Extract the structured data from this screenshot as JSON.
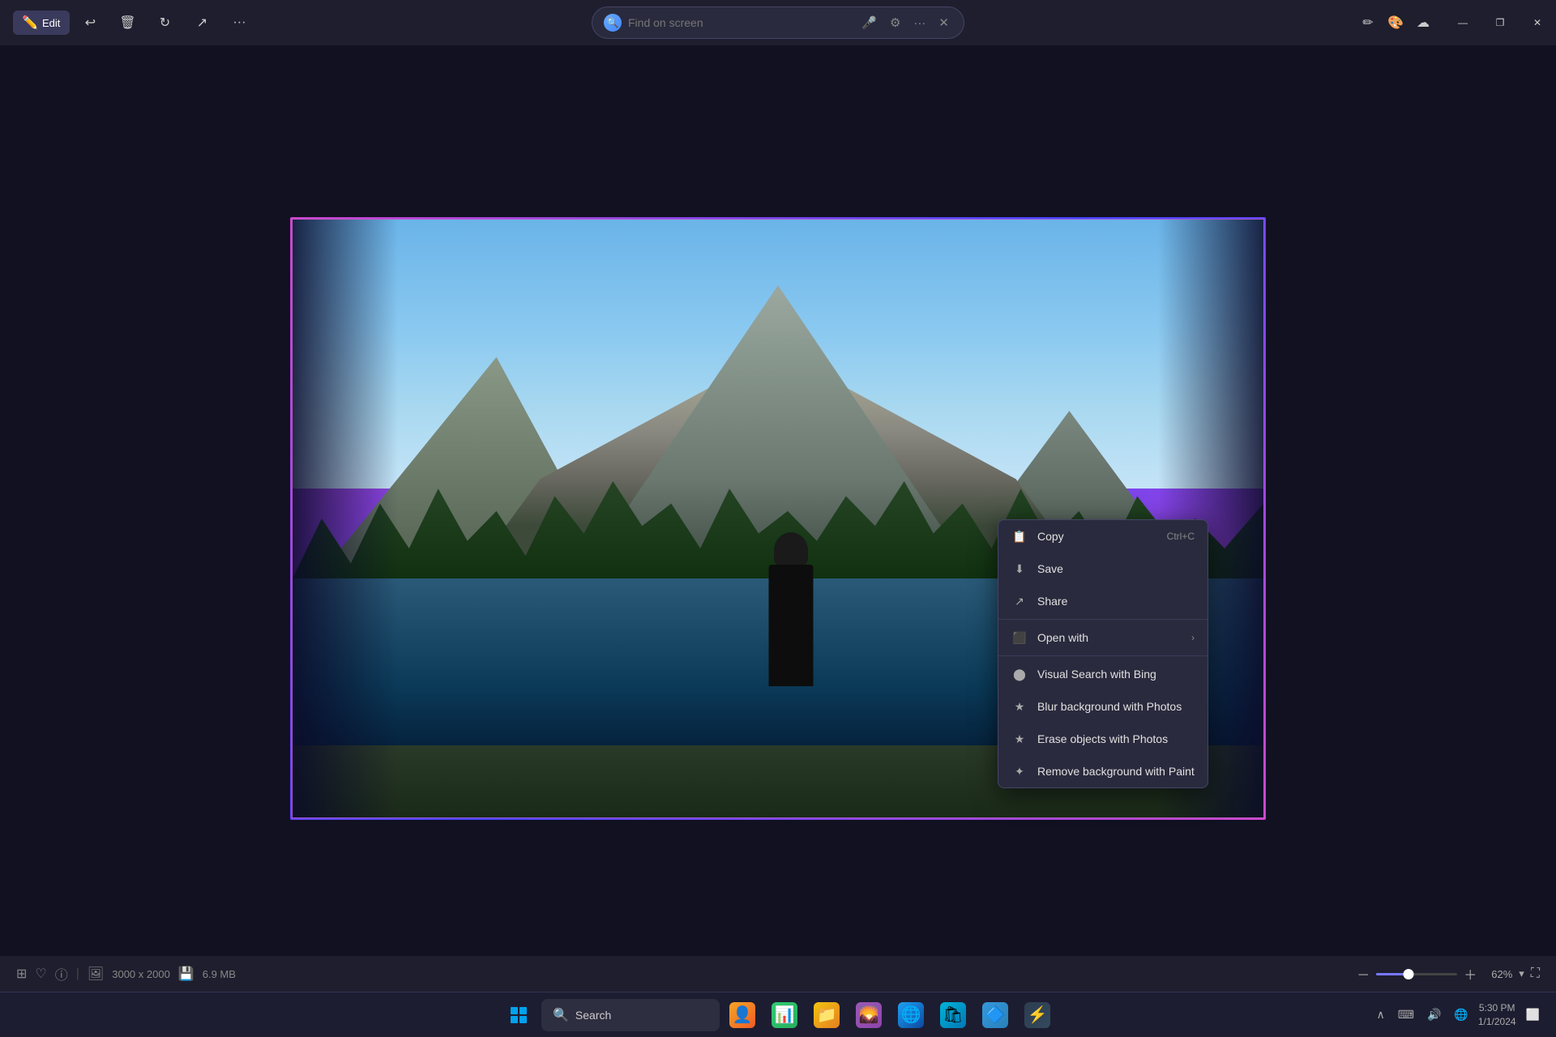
{
  "titlebar": {
    "edit_label": "Edit",
    "toolbar_buttons": [
      "undo-icon",
      "delete-icon",
      "rotate-icon",
      "share-icon",
      "more-icon"
    ],
    "search_placeholder": "Find on screen",
    "close_label": "×",
    "minimize_label": "—",
    "maximize_label": "❐"
  },
  "context_menu": {
    "items": [
      {
        "id": "copy",
        "label": "Copy",
        "shortcut": "Ctrl+C",
        "icon": "📋",
        "has_arrow": false
      },
      {
        "id": "save",
        "label": "Save",
        "shortcut": "",
        "icon": "💾",
        "has_arrow": false
      },
      {
        "id": "share",
        "label": "Share",
        "shortcut": "",
        "icon": "↗",
        "has_arrow": false
      },
      {
        "id": "open-with",
        "label": "Open with",
        "shortcut": "",
        "icon": "⬛",
        "has_arrow": true
      },
      {
        "id": "visual-search",
        "label": "Visual Search with Bing",
        "shortcut": "",
        "icon": "🔍",
        "has_arrow": false
      },
      {
        "id": "blur-bg",
        "label": "Blur background with Photos",
        "shortcut": "",
        "icon": "★",
        "has_arrow": false
      },
      {
        "id": "erase-objects",
        "label": "Erase objects with Photos",
        "shortcut": "",
        "icon": "★",
        "has_arrow": false
      },
      {
        "id": "remove-bg",
        "label": "Remove background with Paint",
        "shortcut": "",
        "icon": "✦",
        "has_arrow": false
      }
    ]
  },
  "status_bar": {
    "dimensions": "3000 x 2000",
    "file_size": "6.9 MB",
    "zoom_level": "62%"
  },
  "taskbar": {
    "search_text": "Search",
    "apps": [
      {
        "name": "start",
        "label": "Start"
      },
      {
        "name": "search",
        "label": "Search"
      },
      {
        "name": "user",
        "label": "User"
      },
      {
        "name": "charts",
        "label": "Charts"
      },
      {
        "name": "explorer",
        "label": "File Explorer"
      },
      {
        "name": "photos",
        "label": "Photos"
      },
      {
        "name": "edge",
        "label": "Edge"
      },
      {
        "name": "store",
        "label": "Store"
      },
      {
        "name": "msedge2",
        "label": "Edge 2"
      },
      {
        "name": "app9",
        "label": "App"
      }
    ]
  }
}
